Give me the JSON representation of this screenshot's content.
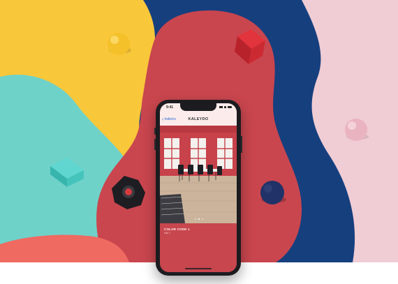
{
  "phone": {
    "status_time": "9:41",
    "back_label": "Indietro",
    "nav_title": "KALEYDO",
    "color_name": "COLOR CODE 1",
    "color_code": "lollo 1",
    "pager_count": 3,
    "pager_active": 1
  },
  "colors": {
    "yellow": "#f9c73a",
    "teal": "#6fd2c9",
    "coral": "#ef6a61",
    "red": "#c9464e",
    "navy": "#163f7e",
    "pink": "#f0ccd4",
    "accent_blue": "#2f6fd6"
  }
}
